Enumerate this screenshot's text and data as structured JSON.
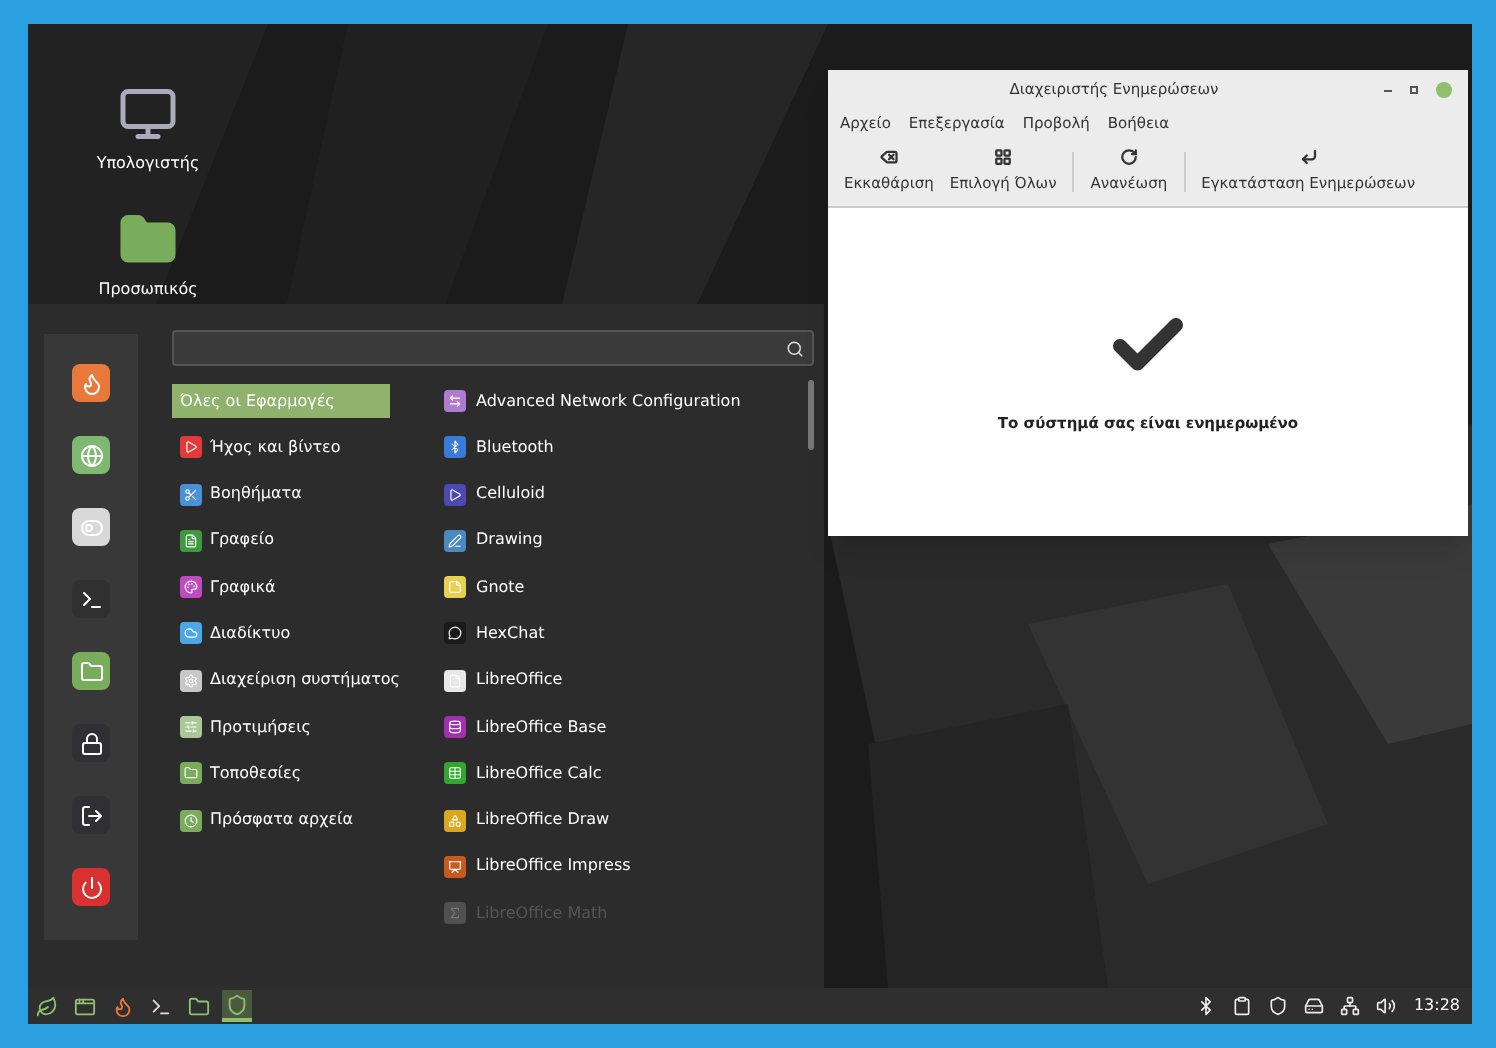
{
  "desktop_icons": [
    {
      "label": "Υπολογιστής",
      "kind": "computer"
    },
    {
      "label": "Προσωπικός",
      "kind": "folder"
    }
  ],
  "menu": {
    "favorites": [
      {
        "kind": "firefox",
        "color": "#e8793a"
      },
      {
        "kind": "globe",
        "color": "#7fb870"
      },
      {
        "kind": "toggles",
        "color": "#d8d8d8"
      },
      {
        "kind": "terminal",
        "color": "#303030"
      },
      {
        "kind": "folder",
        "color": "#79ad5c"
      },
      {
        "kind": "lock",
        "color": "#303034"
      },
      {
        "kind": "logout",
        "color": "#303034"
      },
      {
        "kind": "power",
        "color": "#d93030"
      }
    ],
    "categories": [
      {
        "label": "Όλες οι Εφαρμογές",
        "selected": true
      },
      {
        "label": "Ήχος και βίντεο",
        "selected": false,
        "color": "#e23a3a"
      },
      {
        "label": "Βοηθήματα",
        "selected": false,
        "color": "#4a90d9"
      },
      {
        "label": "Γραφείο",
        "selected": false,
        "color": "#3f9a3f"
      },
      {
        "label": "Γραφικά",
        "selected": false,
        "color": "#c04ac0"
      },
      {
        "label": "Διαδίκτυο",
        "selected": false,
        "color": "#4aa8e8"
      },
      {
        "label": "Διαχείριση συστήματος",
        "selected": false,
        "color": "#c8c8c8"
      },
      {
        "label": "Προτιμήσεις",
        "selected": false,
        "color": "#a8c898"
      },
      {
        "label": "Τοποθεσίες",
        "selected": false,
        "color": "#79ad5c"
      },
      {
        "label": "Πρόσφατα αρχεία",
        "selected": false,
        "color": "#79ad5c"
      }
    ],
    "apps": [
      {
        "label": "Advanced Network Configuration",
        "color": "#b07ad0",
        "dimmed": false
      },
      {
        "label": "Bluetooth",
        "color": "#3a7ad9",
        "dimmed": false
      },
      {
        "label": "Celluloid",
        "color": "#4a4ab0",
        "dimmed": false
      },
      {
        "label": "Drawing",
        "color": "#4a8ac0",
        "dimmed": false
      },
      {
        "label": "Gnote",
        "color": "#e8d050",
        "dimmed": false
      },
      {
        "label": "HexChat",
        "color": "#1a1a1a",
        "dimmed": false
      },
      {
        "label": "LibreOffice",
        "color": "#e8e8e8",
        "dimmed": false
      },
      {
        "label": "LibreOffice Base",
        "color": "#a030b0",
        "dimmed": false
      },
      {
        "label": "LibreOffice Calc",
        "color": "#30a830",
        "dimmed": false
      },
      {
        "label": "LibreOffice Draw",
        "color": "#d8a820",
        "dimmed": false
      },
      {
        "label": "LibreOffice Impress",
        "color": "#c85a20",
        "dimmed": false
      },
      {
        "label": "LibreOffice Math",
        "color": "#505050",
        "dimmed": true
      }
    ]
  },
  "window": {
    "title": "Διαχειριστής Ενημερώσεων",
    "menus": [
      "Αρχείο",
      "Επεξεργασία",
      "Προβολή",
      "Βοήθεια"
    ],
    "toolbar": [
      {
        "label": "Εκκαθάριση",
        "kind": "clear"
      },
      {
        "label": "Επιλογή Όλων",
        "kind": "select"
      },
      {
        "label": "Ανανέωση",
        "kind": "refresh"
      },
      {
        "label": "Εγκατάσταση Ενημερώσεων",
        "kind": "install"
      }
    ],
    "status": "Το σύστημά σας είναι ενημερωμένο"
  },
  "taskbar": {
    "launchers": [
      {
        "kind": "mint",
        "active": false
      },
      {
        "kind": "desktop",
        "active": false
      },
      {
        "kind": "firefox",
        "active": false
      },
      {
        "kind": "terminal",
        "active": false
      },
      {
        "kind": "files",
        "active": false
      },
      {
        "kind": "updates",
        "active": true
      }
    ],
    "tray": [
      {
        "kind": "bluetooth"
      },
      {
        "kind": "clipboard"
      },
      {
        "kind": "shield"
      },
      {
        "kind": "drive"
      },
      {
        "kind": "network"
      },
      {
        "kind": "volume"
      }
    ],
    "clock": "13:28"
  }
}
